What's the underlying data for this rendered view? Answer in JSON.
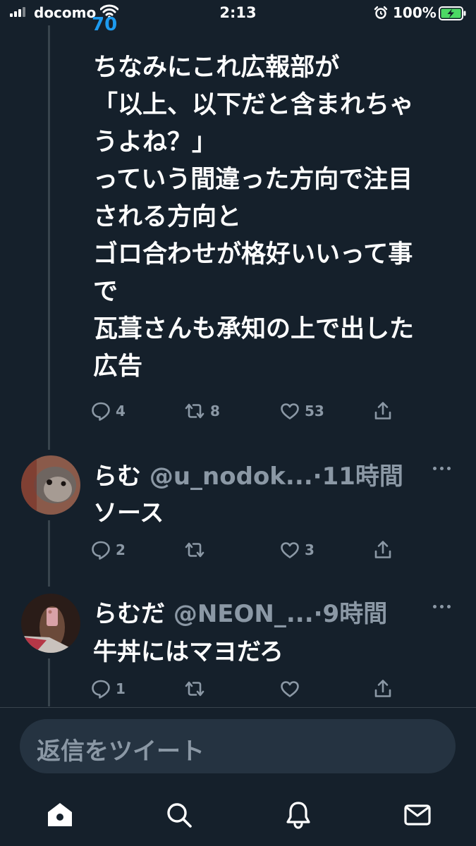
{
  "status_bar": {
    "carrier": "docomo",
    "time": "2:13",
    "battery_percent": "100%",
    "battery_level": 1.0,
    "icons": [
      "signal-icon",
      "wifi-icon",
      "alarm-icon",
      "battery-charging-icon"
    ]
  },
  "partial_top_text": "70",
  "main_tweet": {
    "lines": [
      "ちなみにこれ広報部が",
      "「以上、以下だと含まれちゃ",
      "うよね？」",
      "っていう間違った方向で注目",
      "される方向と",
      "ゴロ合わせが格好いいって事",
      "で",
      "瓦葺さんも承知の上で出した",
      "広告"
    ],
    "reply_count": "4",
    "retweet_count": "8",
    "like_count": "53"
  },
  "replies": [
    {
      "name": "らむ",
      "handle": "@u_nodok...",
      "time": "·11時間",
      "text": "ソース",
      "reply_count": "2",
      "retweet_count": "",
      "like_count": "3"
    },
    {
      "name": "らむだ",
      "handle": "@NEON_...",
      "time": "·9時間",
      "text": "牛丼にはマヨだろ",
      "reply_count": "1",
      "retweet_count": "",
      "like_count": ""
    }
  ],
  "compose": {
    "placeholder": "返信をツイート"
  },
  "tabbar": {
    "items": [
      "home-icon",
      "search-icon",
      "notifications-icon",
      "messages-icon"
    ]
  },
  "colors": {
    "background": "#15202b",
    "secondary_text": "#8b98a5",
    "compose_bg": "#253341",
    "divider": "#38444d",
    "accent": "#1d9bf0"
  }
}
